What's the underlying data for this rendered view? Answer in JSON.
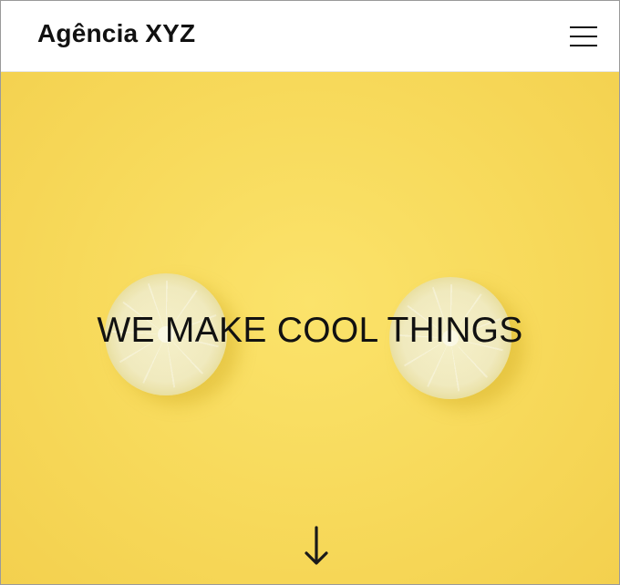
{
  "header": {
    "brand": "Agência XYZ",
    "menu_icon": "hamburger-menu-icon"
  },
  "hero": {
    "title": "WE MAKE COOL THINGS",
    "scroll_icon": "arrow-down-icon",
    "background_color": "#f7d95a"
  }
}
